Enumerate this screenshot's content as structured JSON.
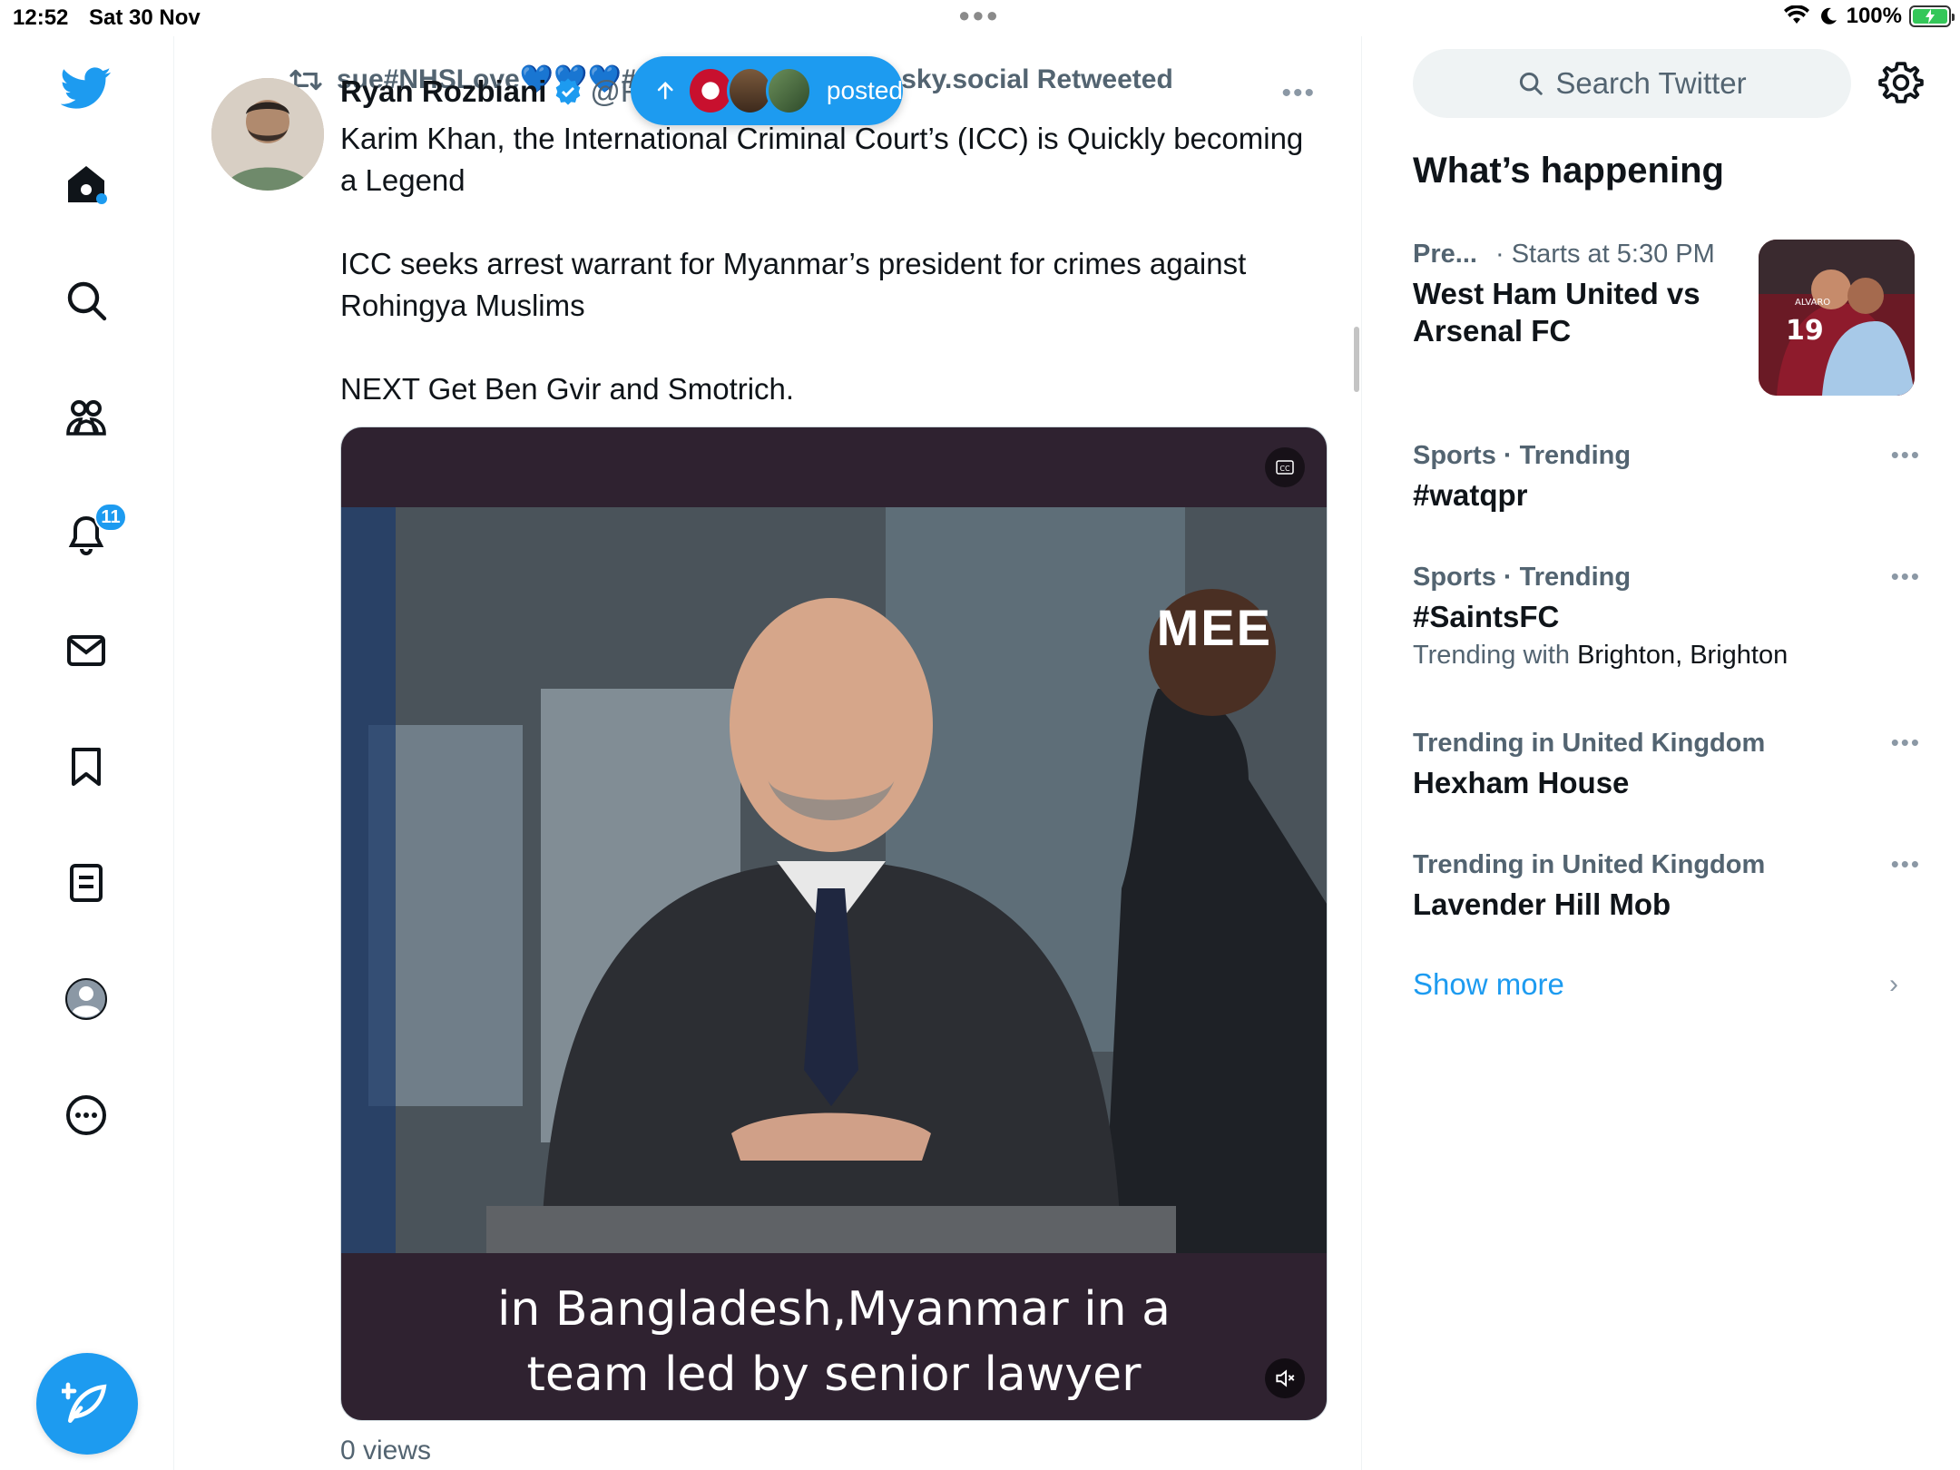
{
  "status_bar": {
    "time": "12:52",
    "date": "Sat 30 Nov",
    "battery_percent": "100%",
    "battery_level": 1.0
  },
  "left_nav": {
    "items": [
      {
        "name": "twitter-logo",
        "icon": "bird-icon"
      },
      {
        "name": "home",
        "icon": "home-icon"
      },
      {
        "name": "explore",
        "icon": "search-icon"
      },
      {
        "name": "communities",
        "icon": "people-icon"
      },
      {
        "name": "notifications",
        "icon": "bell-icon"
      },
      {
        "name": "messages",
        "icon": "envelope-icon"
      },
      {
        "name": "bookmarks",
        "icon": "bookmark-icon"
      },
      {
        "name": "lists",
        "icon": "list-icon"
      },
      {
        "name": "profile",
        "icon": "avatar-icon"
      },
      {
        "name": "more",
        "icon": "ellipsis-circle-icon"
      }
    ],
    "notifications_badge": "11",
    "compose_icon": "compose-icon"
  },
  "tweet": {
    "retweeted_by": "sue#NHSLove💙💙💙#FBNHS suesuezep.bsky.social Retweeted",
    "author_name": "Ryan Rozbiani",
    "author_handle": "@R",
    "posted_pill_label": "posted",
    "paragraphs": [
      "Karim Khan, the International Criminal Court’s (ICC) is Quickly becoming a Legend",
      "ICC seeks arrest warrant for Myanmar’s president for crimes against Rohingya Muslims",
      "NEXT Get Ben Gvir and Smotrich."
    ],
    "video_caption_line1": "in Bangladesh,Myanmar in a",
    "video_caption_line2": "team led by senior lawyer",
    "video_watermark": "MEE",
    "views": "0 views"
  },
  "right_col": {
    "search_placeholder": "Search Twitter",
    "section_title": "What’s happening",
    "trends": [
      {
        "meta_category": "Pre...",
        "meta_extra": "· Starts at 5:30 PM",
        "title": "West Ham United vs Arsenal FC",
        "has_image": true
      },
      {
        "meta_category": "Sports · Trending",
        "title": "#watqpr"
      },
      {
        "meta_category": "Sports · Trending",
        "title": "#SaintsFC",
        "sub_prefix": "Trending with",
        "sub_strong": "Brighton, Brighton"
      },
      {
        "meta_category": "Trending in United Kingdom",
        "title": "Hexham House"
      },
      {
        "meta_category": "Trending in United Kingdom",
        "title": "Lavender Hill Mob"
      }
    ],
    "show_more": "Show more"
  }
}
